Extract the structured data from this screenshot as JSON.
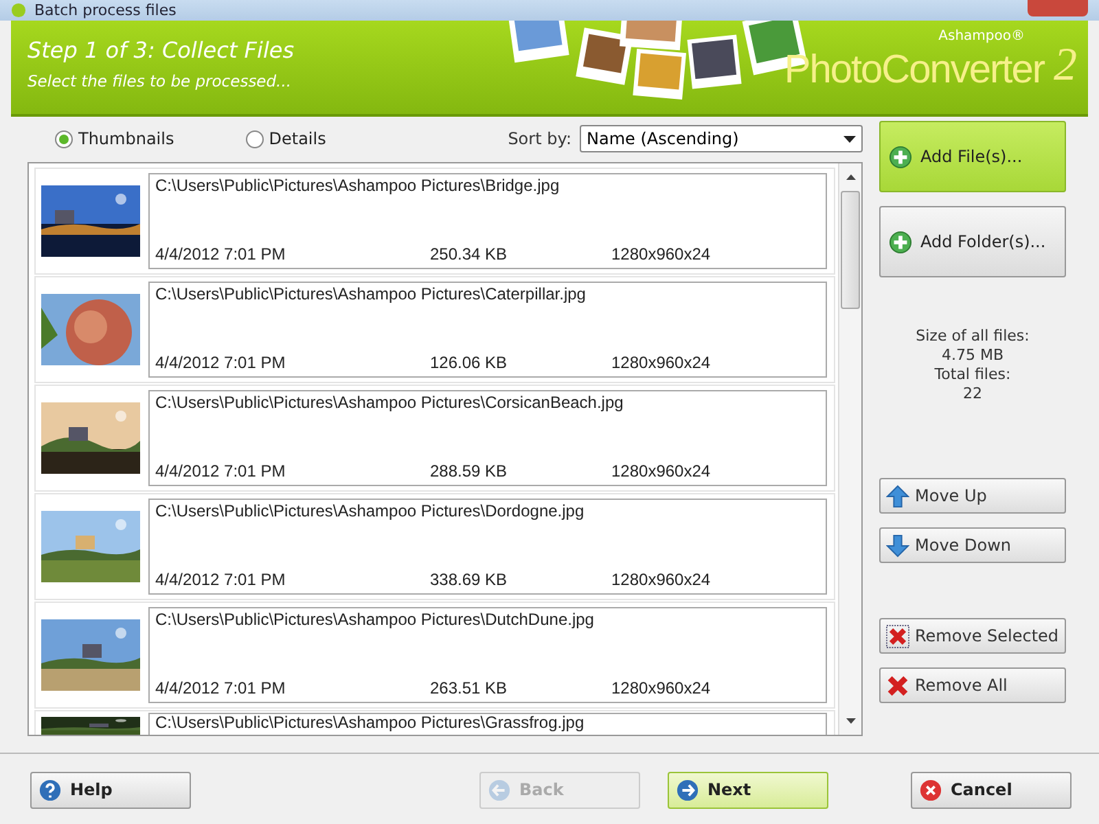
{
  "window": {
    "title": "Batch process files"
  },
  "header": {
    "step": "Step 1 of 3: Collect Files",
    "subtitle": "Select the files to be processed...",
    "brand": "Ashampoo®",
    "product": "PhotoConverter",
    "version": "2"
  },
  "view_options": [
    {
      "label": "Thumbnails",
      "selected": true
    },
    {
      "label": "Details",
      "selected": false
    }
  ],
  "sort": {
    "label": "Sort by:",
    "value": "Name (Ascending)"
  },
  "files": [
    {
      "path": "C:\\Users\\Public\\Pictures\\Ashampoo Pictures\\Bridge.jpg",
      "date": "4/4/2012 7:01 PM",
      "size": "250.34 KB",
      "dimensions": "1280x960x24"
    },
    {
      "path": "C:\\Users\\Public\\Pictures\\Ashampoo Pictures\\Caterpillar.jpg",
      "date": "4/4/2012 7:01 PM",
      "size": "126.06 KB",
      "dimensions": "1280x960x24"
    },
    {
      "path": "C:\\Users\\Public\\Pictures\\Ashampoo Pictures\\CorsicanBeach.jpg",
      "date": "4/4/2012 7:01 PM",
      "size": "288.59 KB",
      "dimensions": "1280x960x24"
    },
    {
      "path": "C:\\Users\\Public\\Pictures\\Ashampoo Pictures\\Dordogne.jpg",
      "date": "4/4/2012 7:01 PM",
      "size": "338.69 KB",
      "dimensions": "1280x960x24"
    },
    {
      "path": "C:\\Users\\Public\\Pictures\\Ashampoo Pictures\\DutchDune.jpg",
      "date": "4/4/2012 7:01 PM",
      "size": "263.51 KB",
      "dimensions": "1280x960x24"
    },
    {
      "path": "C:\\Users\\Public\\Pictures\\Ashampoo Pictures\\Grassfrog.jpg"
    }
  ],
  "side_buttons_top": [
    {
      "label": "Add File(s)...",
      "kind": "plus",
      "highlighted": true
    },
    {
      "label": "Add Folder(s)...",
      "kind": "plus",
      "highlighted": false
    }
  ],
  "summary": [
    "Size of all files:",
    "4.75 MB",
    "Total files:",
    "22"
  ],
  "move_buttons": [
    {
      "label": "Move Up",
      "kind": "up"
    },
    {
      "label": "Move Down",
      "kind": "down"
    }
  ],
  "remove_buttons": [
    {
      "label": "Remove Selected",
      "kind": "removeselected"
    },
    {
      "label": "Remove All",
      "kind": "remove"
    }
  ],
  "footer_buttons": [
    {
      "label": "Help",
      "kind": "help",
      "disabled": false,
      "highlighted": false
    },
    {
      "label": "Back",
      "kind": "back",
      "disabled": true,
      "highlighted": false
    },
    {
      "label": "Next",
      "kind": "next",
      "disabled": false,
      "highlighted": true
    },
    {
      "label": "Cancel",
      "kind": "cancel",
      "disabled": false,
      "highlighted": false
    }
  ]
}
